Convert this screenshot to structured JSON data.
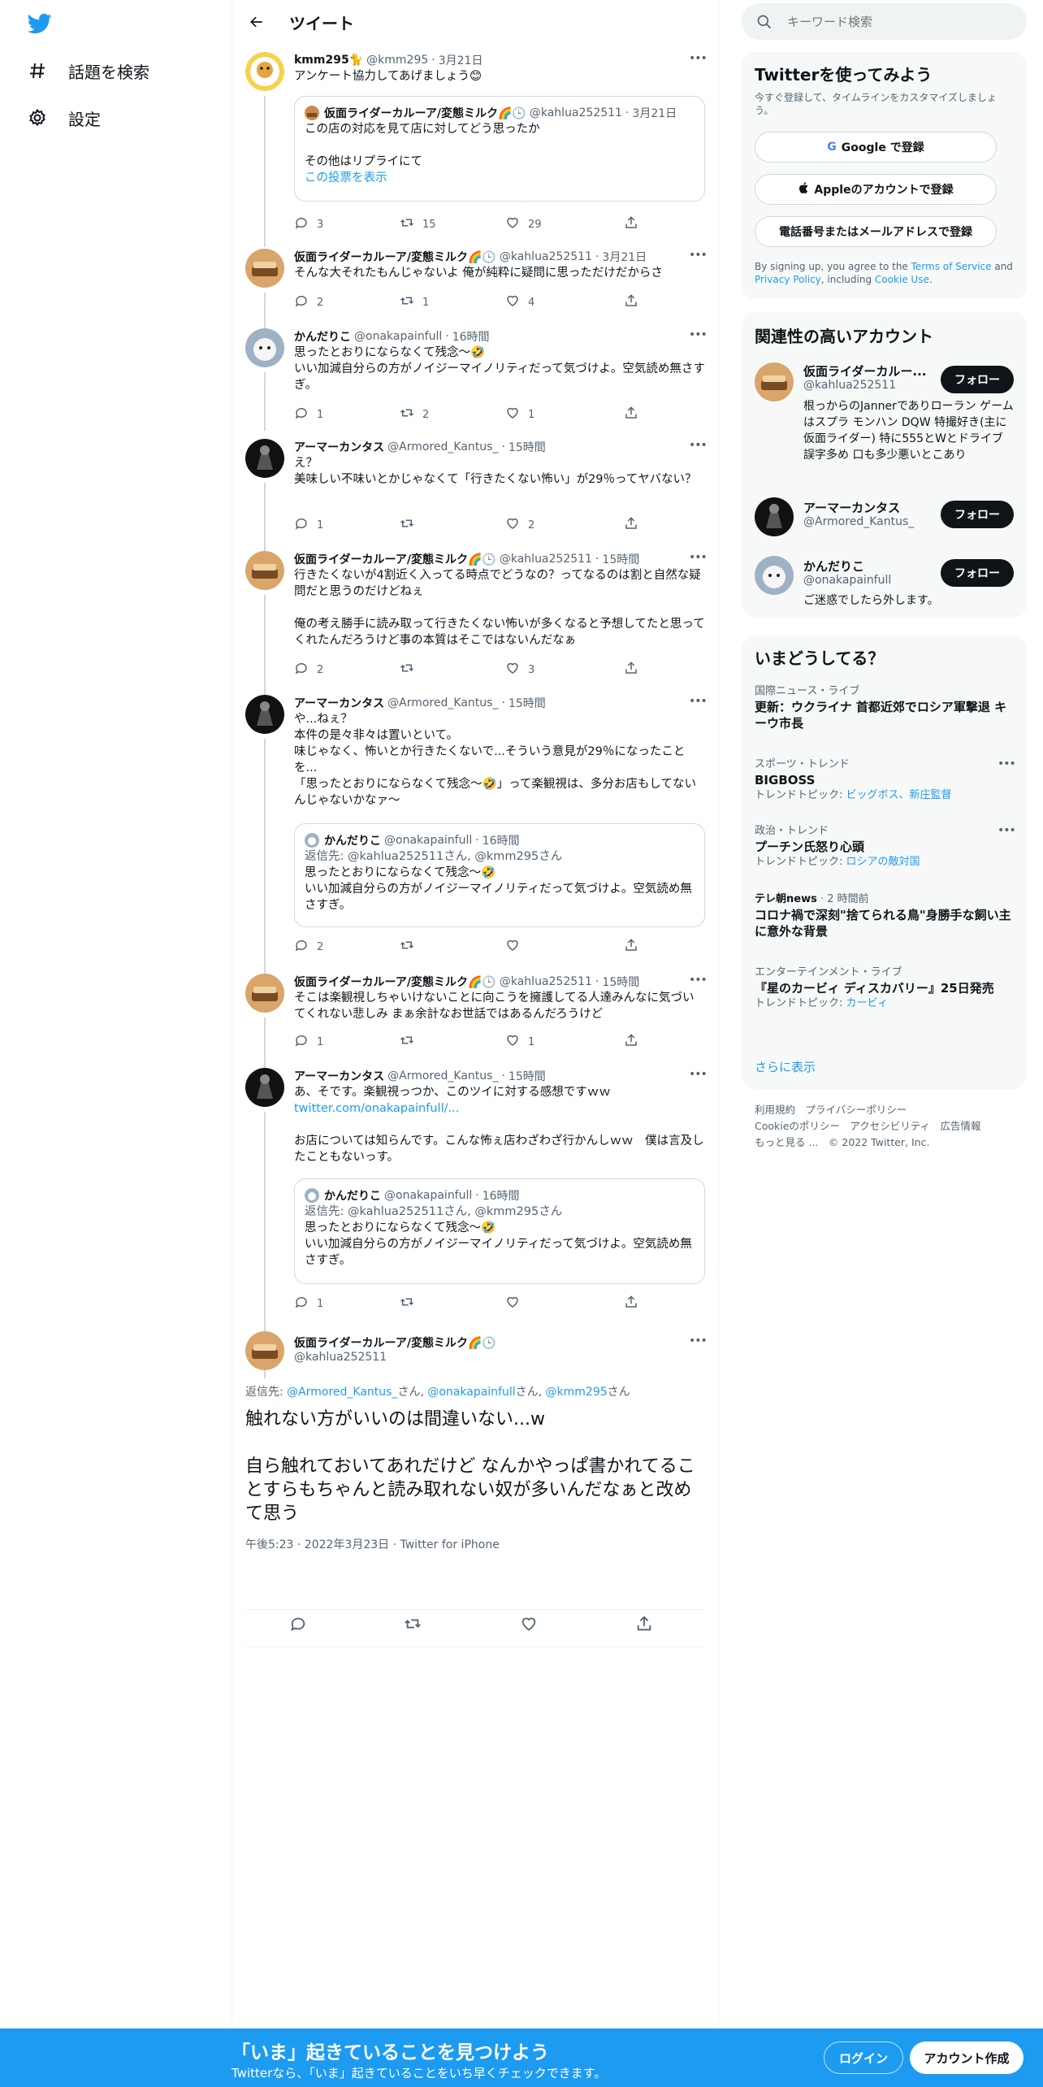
{
  "nav": {
    "items": [
      {
        "label": "話題を検索"
      },
      {
        "label": "設定"
      }
    ]
  },
  "header": {
    "title": "ツイート"
  },
  "tweets": [
    {
      "name": "kmm295🐈",
      "handle": "@kmm295",
      "time": "3月21日",
      "text": "アンケート協力してあげましょう😊",
      "quote": {
        "name": "仮面ライダーカルーア/変態ミルク🌈🕒",
        "handle": "@kahlua252511",
        "time": "3月21日",
        "text": "この店の対応を見て店に対してどう思ったか\n\nその他はリプライにて",
        "link": "この投票を表示"
      },
      "replies": "3",
      "retweets": "15",
      "likes": "29"
    },
    {
      "name": "仮面ライダーカルーア/変態ミルク🌈🕒",
      "handle": "@kahlua252511",
      "time": "3月21日",
      "text": "そんな大それたもんじゃないよ 俺が純粋に疑問に思っただけだからさ",
      "replies": "2",
      "retweets": "1",
      "likes": "4"
    },
    {
      "name": "かんだりこ",
      "handle": "@onakapainfull",
      "time": "16時間",
      "text": "思ったとおりにならなくて残念〜🤣\nいい加減自分らの方がノイジーマイノリティだって気づけよ。空気読め無さすぎ。",
      "replies": "1",
      "retweets": "2",
      "likes": "1"
    },
    {
      "name": "アーマーカンタス",
      "handle": "@Armored_Kantus_",
      "time": "15時間",
      "text": "え？\n美味しい不味いとかじゃなくて「行きたくない怖い」が29％ってヤバない？",
      "replies": "1",
      "retweets": "",
      "likes": "2"
    },
    {
      "name": "仮面ライダーカルーア/変態ミルク🌈🕒",
      "handle": "@kahlua252511",
      "time": "15時間",
      "text": "行きたくないが4割近く入ってる時点でどうなの？ってなるのは割と自然な疑問だと思うのだけどねぇ\n\n俺の考え勝手に読み取って行きたくない怖いが多くなると予想してたと思ってくれたんだろうけど事の本質はそこではないんだなぁ",
      "replies": "2",
      "retweets": "",
      "likes": "3"
    },
    {
      "name": "アーマーカンタス",
      "handle": "@Armored_Kantus_",
      "time": "15時間",
      "text": "や...ねぇ？\n本件の是々非々は置いといて。\n味じゃなく、怖いとか行きたくないで...そういう意見が29％になったことを...\n「思ったとおりにならなくて残念〜🤣」って楽観視は、多分お店もしてないんじゃないかなァ～",
      "quote": {
        "name": "かんだりこ",
        "handle": "@onakapainfull",
        "time": "16時間",
        "replyto": "返信先: @kahlua252511さん, @kmm295さん",
        "text": "思ったとおりにならなくて残念〜🤣\nいい加減自分らの方がノイジーマイノリティだって気づけよ。空気読め無さすぎ。"
      },
      "replies": "2",
      "retweets": "",
      "likes": ""
    },
    {
      "name": "仮面ライダーカルーア/変態ミルク🌈🕒",
      "handle": "@kahlua252511",
      "time": "15時間",
      "text": "そこは楽観視しちゃいけないことに向こうを擁護してる人達みんなに気づいてくれない悲しみ まぁ余計なお世話ではあるんだろうけど",
      "replies": "1",
      "retweets": "",
      "likes": "1"
    },
    {
      "name": "アーマーカンタス",
      "handle": "@Armored_Kantus_",
      "time": "15時間",
      "text": "あ、そです。楽観視っつか、このツイに対する感想ですｗｗ",
      "link": "twitter.com/onakapainfull/...",
      "text2": "お店については知らんです。こんな怖ぇ店わざわざ行かんしｗｗ　僕は言及したこともないっす。",
      "quote": {
        "name": "かんだりこ",
        "handle": "@onakapainfull",
        "time": "16時間",
        "replyto": "返信先: @kahlua252511さん, @kmm295さん",
        "text": "思ったとおりにならなくて残念〜🤣\nいい加減自分らの方がノイジーマイノリティだって気づけよ。空気読め無さすぎ。"
      },
      "replies": "1",
      "retweets": "",
      "likes": ""
    }
  ],
  "main_tweet": {
    "name": "仮面ライダーカルーア/変態ミルク🌈🕒",
    "handle": "@kahlua252511",
    "replyto_prefix": "返信先: ",
    "replyto_1": "@Armored_Kantus_",
    "replyto_sep1": "さん, ",
    "replyto_2": "@onakapainfull",
    "replyto_sep2": "さん, ",
    "replyto_3": "@kmm295",
    "replyto_suffix": "さん",
    "text": "触れない方がいいのは間違いない...w\n\n自ら触れておいてあれだけど なんかやっぱ書かれてることすらもちゃんと読み取れない奴が多いんだなぁと改めて思う",
    "meta": "午後5:23 · 2022年3月23日 · Twitter for iPhone"
  },
  "right": {
    "search_placeholder": "キーワード検索",
    "signup": {
      "title": "Twitterを使ってみよう",
      "desc": "今すぐ登録して、タイムラインをカスタマイズしましょう。",
      "google": "Google で登録",
      "apple": "Appleのアカウントで登録",
      "phone": "電話番号またはメールアドレスで登録",
      "terms_1": "By signing up, you agree to the ",
      "terms_tos": "Terms of Service",
      "terms_2": " and ",
      "terms_pp": "Privacy Policy",
      "terms_3": ", including ",
      "terms_cookie": "Cookie Use",
      "terms_4": "."
    },
    "related": {
      "title": "関連性の高いアカウント",
      "follow": "フォロー",
      "accounts": [
        {
          "name": "仮面ライダーカルー...",
          "handle": "@kahlua252511",
          "bio": "根っからのJannerでありローラン ゲームはスプラ モンハン DQW 特撮好き(主に仮面ライダー) 特に555とWとドライブ 誤字多め 口も多少悪いとこあり"
        },
        {
          "name": "アーマーカンタス",
          "handle": "@Armored_Kantus_",
          "bio": ""
        },
        {
          "name": "かんだりこ",
          "handle": "@onakapainfull",
          "bio": "ご迷惑でしたら外します。"
        }
      ]
    },
    "trends": {
      "title": "いまどうしてる？",
      "items": [
        {
          "cat": "国際ニュース・ライブ",
          "title": "更新：ウクライナ 首都近郊でロシア軍撃退 キーウ市長",
          "sub_prefix": "",
          "sub_link": ""
        },
        {
          "cat": "スポーツ・トレンド",
          "title": "BIGBOSS",
          "sub_prefix": "トレンドトピック: ",
          "sub_link": "ビッグボス、新庄監督"
        },
        {
          "cat": "政治・トレンド",
          "title": "プーチン氏怒り心頭",
          "sub_prefix": "トレンドトピック: ",
          "sub_link": "ロシアの敵対国"
        },
        {
          "cat": "テレ朝news",
          "cat_time": "· 2 時間前",
          "title": "コロナ禍で深刻\"捨てられる鳥\"身勝手な飼い主に意外な背景",
          "sub_prefix": "",
          "sub_link": ""
        },
        {
          "cat": "エンターテインメント・ライブ",
          "title": "『星のカービィ ディスカバリー』25日発売",
          "sub_prefix": "トレンドトピック: ",
          "sub_link": "カービィ"
        }
      ],
      "more": "さらに表示"
    },
    "footer": {
      "l1": "利用規約　プライバシーポリシー",
      "l2": "Cookieのポリシー　アクセシビリティ　広告情報",
      "l3": "もっと見る ...　© 2022 Twitter, Inc."
    }
  },
  "bottombar": {
    "title": "「いま」起きていることを見つけよう",
    "subtitle": "Twitterなら、「いま」起きていることをいち早くチェックできます。",
    "login": "ログイン",
    "signup": "アカウント作成"
  },
  "colors": {
    "accent": "#1d9bf0",
    "text": "#0f1419",
    "muted": "#536471"
  }
}
